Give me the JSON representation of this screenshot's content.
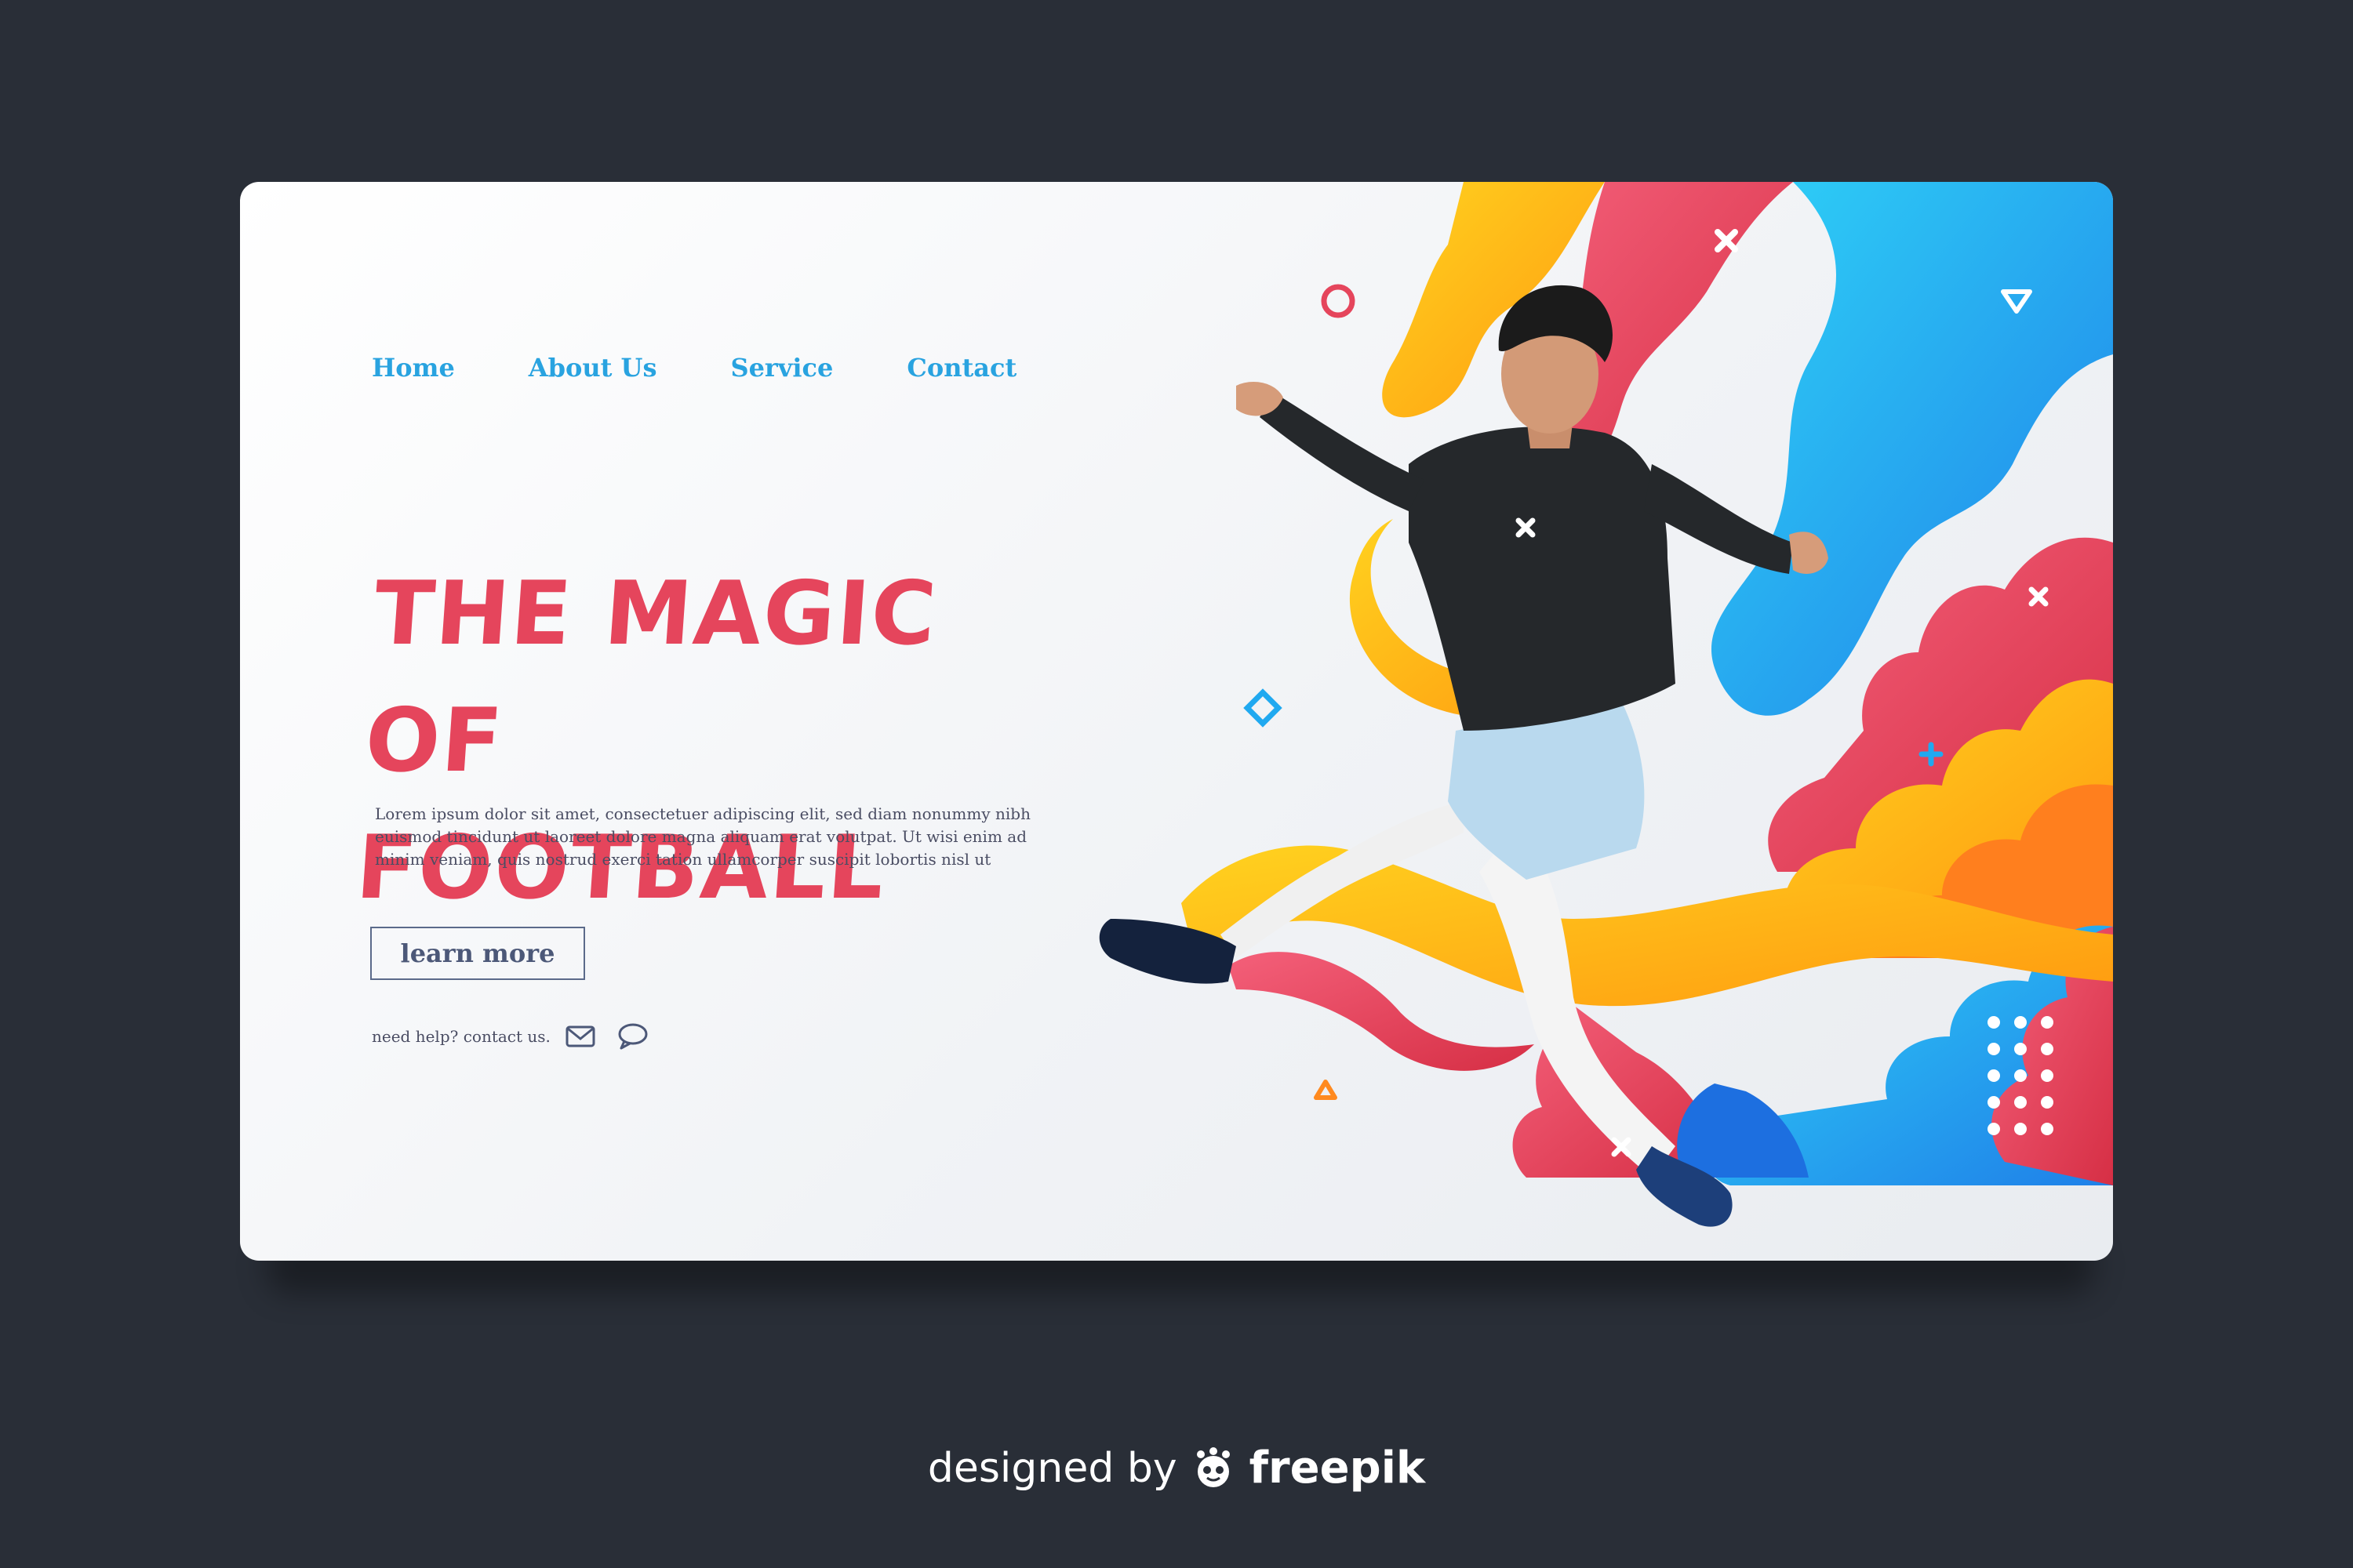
{
  "nav": {
    "items": [
      {
        "label": "Home"
      },
      {
        "label": "About Us"
      },
      {
        "label": "Service"
      },
      {
        "label": "Contact"
      }
    ]
  },
  "hero": {
    "headline": "THE MAGIC OF FOOTBALL",
    "body": "Lorem ipsum dolor sit amet, consectetuer adipiscing elit, sed diam nonummy nibh euismod tincidunt ut laoreet dolore magna aliquam erat volutpat. Ut wisi enim ad minim veniam, quis nostrud exerci tation ullamcorper suscipit lobortis nisl ut",
    "cta_label": "learn more",
    "help_text": "need help? contact us."
  },
  "footer": {
    "prefix": "designed by",
    "brand": "freepik"
  },
  "colors": {
    "background": "#292e37",
    "nav": "#29a3e0",
    "headline": "#e5455c",
    "red": "#e84a5f",
    "yellow": "#fcb316",
    "blue": "#20a9f0",
    "orange": "#ff8a1f"
  },
  "icons": [
    "mail-icon",
    "chat-icon",
    "freepik-logo-icon"
  ]
}
